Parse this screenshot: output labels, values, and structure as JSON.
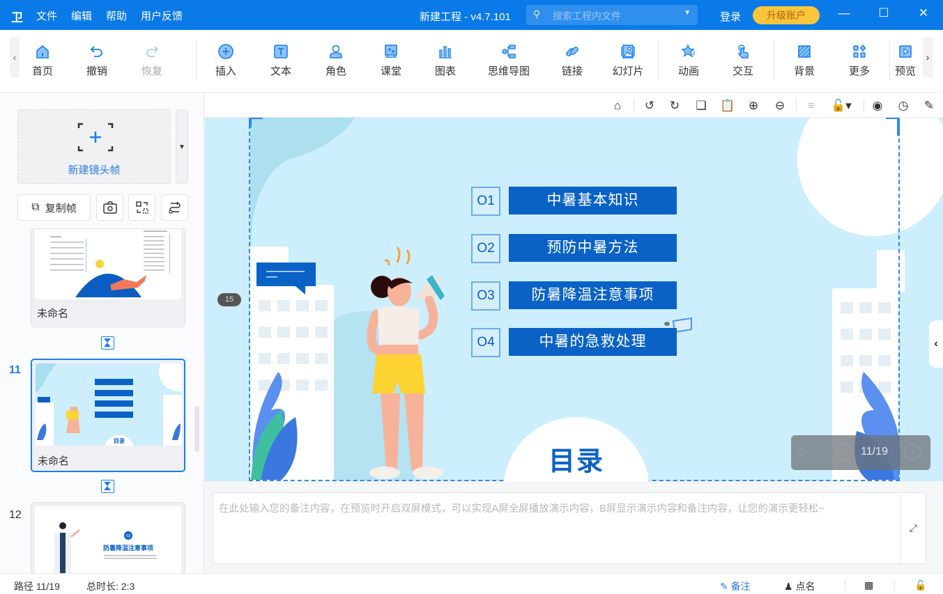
{
  "titlebar": {
    "logo": "卫",
    "menu": [
      "文件",
      "编辑",
      "帮助",
      "用户反馈"
    ],
    "title": "新建工程 - v4.7.101",
    "search_placeholder": "搜索工程内文件",
    "login": "登录",
    "upgrade": "升级账户"
  },
  "toolbar": {
    "items": [
      {
        "label": "首页",
        "icon": "home-icon"
      },
      {
        "label": "撤销",
        "icon": "undo-icon"
      },
      {
        "label": "恢复",
        "icon": "redo-icon",
        "disabled": true
      },
      {
        "label": "插入",
        "icon": "plus-circle-icon"
      },
      {
        "label": "文本",
        "icon": "text-icon"
      },
      {
        "label": "角色",
        "icon": "character-icon"
      },
      {
        "label": "课堂",
        "icon": "classroom-icon"
      },
      {
        "label": "图表",
        "icon": "chart-icon"
      },
      {
        "label": "思维导图",
        "icon": "mindmap-icon"
      },
      {
        "label": "链接",
        "icon": "link-icon"
      },
      {
        "label": "幻灯片",
        "icon": "slide-icon"
      },
      {
        "label": "动画",
        "icon": "animation-star-icon"
      },
      {
        "label": "交互",
        "icon": "interaction-hand-icon"
      },
      {
        "label": "背景",
        "icon": "background-icon"
      },
      {
        "label": "更多",
        "icon": "more-grid-icon"
      },
      {
        "label": "预览",
        "icon": "preview-play-icon"
      }
    ]
  },
  "leftpanel": {
    "new_frame": "新建镜头帧",
    "copy_frame": "复制帧",
    "thumbs": [
      {
        "num": "",
        "name": "未命名"
      },
      {
        "num": "11",
        "name": "未命名",
        "active": true
      },
      {
        "num": "12",
        "name": ""
      }
    ],
    "thumb12_title": "防暑降温注意事项",
    "thumb12_badge": "03"
  },
  "slide": {
    "page_badge": "15",
    "toc": [
      {
        "num": "O1",
        "label": "中暑基本知识"
      },
      {
        "num": "O2",
        "label": "预防中暑方法"
      },
      {
        "num": "O3",
        "label": "防暑降温注意事项"
      },
      {
        "num": "O4",
        "label": "中暑的急救处理"
      }
    ],
    "title": "目录",
    "counter": "11/19"
  },
  "notes": {
    "placeholder": "在此处输入您的备注内容，在预览时开启双屏模式，可以实现A屏全屏播放演示内容，B屏显示演示内容和备注内容，让您的演示更轻松~"
  },
  "statusbar": {
    "path": "路径 11/19",
    "duration": "总时长: 2:3",
    "notes_btn": "备注",
    "rollcall_btn": "点名"
  },
  "colors": {
    "brand": "#0a7ae8",
    "upgrade": "#fbc53a",
    "slide_bg": "#cdeefc",
    "toc_bar": "#0a62c6"
  }
}
